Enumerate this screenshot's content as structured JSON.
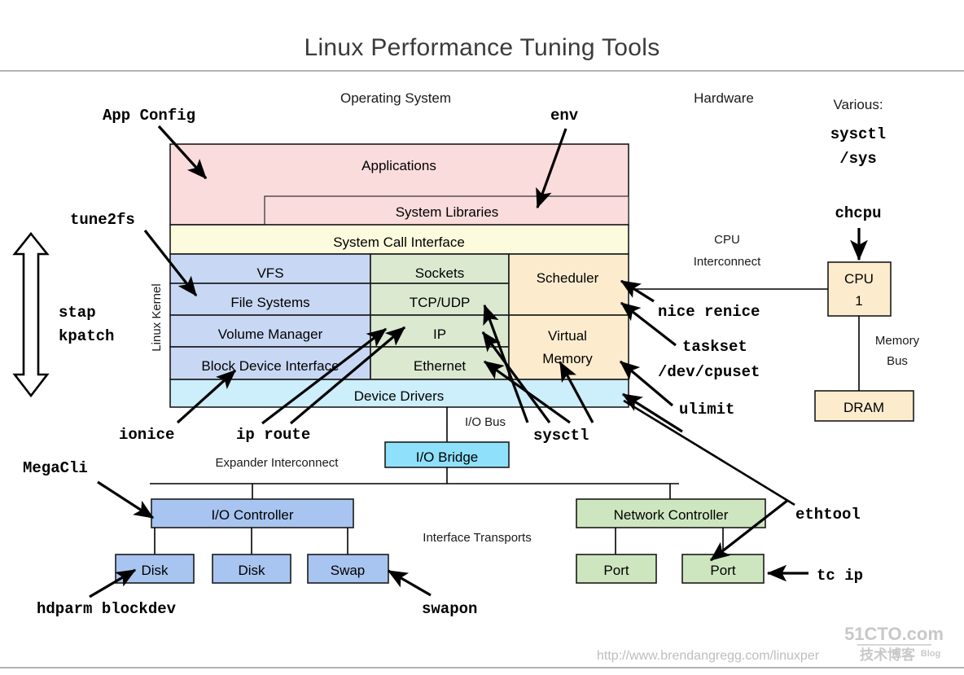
{
  "title": "Linux Performance Tuning Tools",
  "sections": {
    "operating_system": "Operating System",
    "hardware": "Hardware",
    "various_label": "Various:"
  },
  "kernel_side_label": "Linux Kernel",
  "stack": {
    "applications": "Applications",
    "system_libraries": "System Libraries",
    "system_call_interface": "System Call Interface",
    "vfs": "VFS",
    "file_systems": "File Systems",
    "volume_manager": "Volume Manager",
    "block_device_interface": "Block Device Interface",
    "sockets": "Sockets",
    "tcp_udp": "TCP/UDP",
    "ip": "IP",
    "ethernet": "Ethernet",
    "scheduler": "Scheduler",
    "virtual_memory_line1": "Virtual",
    "virtual_memory_line2": "Memory",
    "device_drivers": "Device Drivers"
  },
  "hardware_boxes": {
    "cpu_line1": "CPU",
    "cpu_line2": "1",
    "dram": "DRAM",
    "io_bridge": "I/O Bridge",
    "io_controller": "I/O Controller",
    "disk_1": "Disk",
    "disk_2": "Disk",
    "swap": "Swap",
    "network_controller": "Network Controller",
    "port_1": "Port",
    "port_2": "Port"
  },
  "bus_labels": {
    "cpu_interconnect_line1": "CPU",
    "cpu_interconnect_line2": "Interconnect",
    "memory_bus_line1": "Memory",
    "memory_bus_line2": "Bus",
    "io_bus": "I/O Bus",
    "expander_interconnect": "Expander Interconnect",
    "interface_transports": "Interface Transports"
  },
  "tools": {
    "app_config": "App Config",
    "env": "env",
    "tune2fs": "tune2fs",
    "stap": "stap",
    "kpatch": "kpatch",
    "ionice": "ionice",
    "ip_route": "ip route",
    "sysctl_bottom": "sysctl",
    "megacli": "MegaCli",
    "hdparm_blockdev": "hdparm blockdev",
    "swapon": "swapon",
    "ethtool": "ethtool",
    "tc_ip": "tc ip",
    "various_sysctl": "sysctl",
    "various_sys": "/sys",
    "chcpu": "chcpu",
    "nice_renice": "nice renice",
    "taskset": "taskset",
    "dev_cpuset": "/dev/cpuset",
    "ulimit": "ulimit"
  },
  "footer": {
    "url": "http://www.brendangregg.com/linuxper",
    "watermark_main": "51CTO.com",
    "watermark_sub": "技术博客",
    "watermark_blog": "Blog"
  },
  "colors": {
    "applications": "#fbdcdc",
    "syscall": "#fdfbdd",
    "filesystem_blue": "#c8d8f4",
    "network_green": "#dbe9d1",
    "cpu_orange": "#fceccd",
    "device_drivers_cyan": "#cdeefb",
    "io_bridge_cyan": "#8fe0fa",
    "io_blue": "#a8c4f0",
    "net_green": "#cde6bf",
    "stroke": "#1a1a1a"
  }
}
